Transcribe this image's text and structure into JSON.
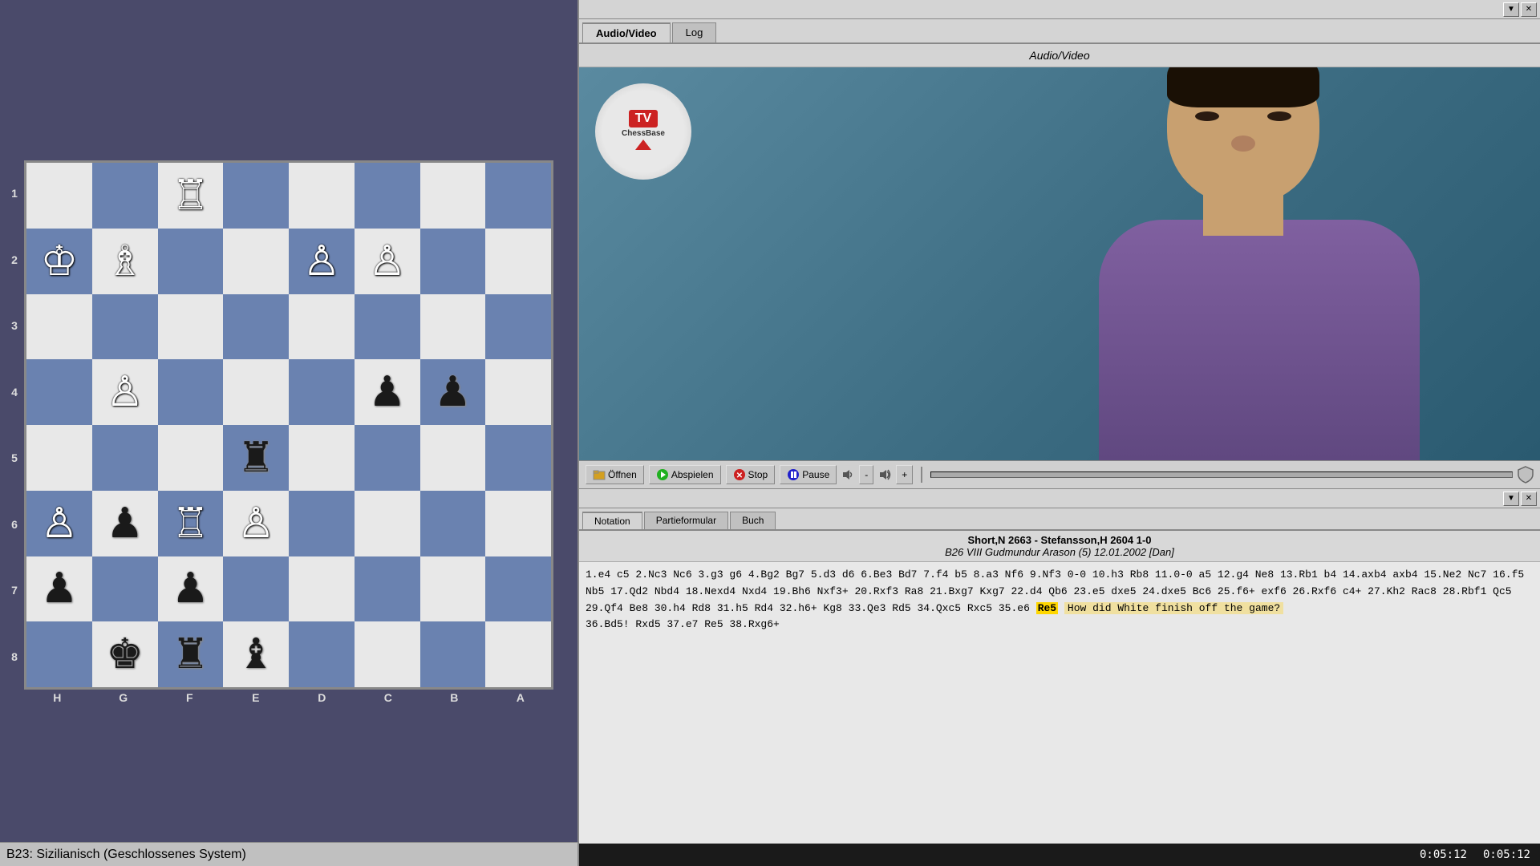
{
  "left_panel": {
    "status_bar": "B23: Sizilianisch (Geschlossenes System)",
    "file_labels": [
      "H",
      "G",
      "F",
      "E",
      "D",
      "C",
      "B",
      "A"
    ],
    "rank_labels": [
      "1",
      "2",
      "3",
      "4",
      "5",
      "6",
      "7",
      "8"
    ],
    "board": {
      "pieces": [
        {
          "row": 0,
          "col": 2,
          "piece": "♜",
          "color": "white",
          "symbol": "♖"
        },
        {
          "row": 1,
          "col": 0,
          "piece": "♚",
          "color": "white",
          "symbol": "♔"
        },
        {
          "row": 1,
          "col": 1,
          "piece": "♝",
          "color": "white",
          "symbol": "♗"
        },
        {
          "row": 1,
          "col": 4,
          "piece": "♟",
          "color": "white",
          "symbol": "♙"
        },
        {
          "row": 1,
          "col": 5,
          "piece": "♟",
          "color": "white",
          "symbol": "♙"
        },
        {
          "row": 3,
          "col": 1,
          "piece": "♟",
          "color": "white",
          "symbol": "♙"
        },
        {
          "row": 3,
          "col": 4,
          "piece": "♟",
          "color": "black",
          "symbol": "♟"
        },
        {
          "row": 3,
          "col": 5,
          "piece": "♟",
          "color": "black",
          "symbol": "♟"
        },
        {
          "row": 4,
          "col": 3,
          "piece": "♜",
          "color": "black",
          "symbol": "♜"
        },
        {
          "row": 5,
          "col": 0,
          "piece": "♟",
          "color": "white",
          "symbol": "♙"
        },
        {
          "row": 5,
          "col": 1,
          "piece": "♟",
          "color": "black",
          "symbol": "♟"
        },
        {
          "row": 5,
          "col": 2,
          "piece": "♜",
          "color": "white",
          "symbol": "♖"
        },
        {
          "row": 5,
          "col": 3,
          "piece": "♟",
          "color": "white",
          "symbol": "♙"
        },
        {
          "row": 6,
          "col": 0,
          "piece": "♟",
          "color": "black",
          "symbol": "♟"
        },
        {
          "row": 6,
          "col": 2,
          "piece": "♟",
          "color": "black",
          "symbol": "♟"
        },
        {
          "row": 7,
          "col": 1,
          "piece": "♚",
          "color": "black",
          "symbol": "♚"
        },
        {
          "row": 7,
          "col": 2,
          "piece": "♜",
          "color": "black",
          "symbol": "♜"
        },
        {
          "row": 7,
          "col": 3,
          "piece": "♝",
          "color": "black",
          "symbol": "♝"
        }
      ]
    }
  },
  "right_panel": {
    "tabs": [
      "Audio/Video",
      "Log"
    ],
    "active_tab": "Audio/Video",
    "av_label": "Audio/Video",
    "logo": {
      "tv": "TV",
      "chessbase": "ChessBase"
    },
    "controls": {
      "open": "Öffnen",
      "play": "Abspielen",
      "stop": "Stop",
      "pause": "Pause",
      "vol_minus": "-",
      "vol_plus": "+"
    }
  },
  "notation": {
    "tabs": [
      "Notation",
      "Partieformular",
      "Buch"
    ],
    "active_tab": "Notation",
    "game_title": "Short,N 2663 - Stefansson,H 2604  1-0",
    "game_info": "B26 VIII Gudmundur Arason (5) 12.01.2002 [Dan]",
    "moves": "1.e4 c5 2.Nc3 Nc6 3.g3 g6 4.Bg2 Bg7 5.d3 d6 6.Be3 Bd7 7.f4 b5 8.a3 Nf6 9.Nf3 0-0 10.h3 Rb8 11.0-0 a5 12.g4 Ne8 13.Rb1 b4 14.axb4 axb4 15.Ne2 Nc7 16.f5 Nb5 17.Qd2 Nbd4 18.Nexd4 Nxd4 19.Bh6 Nxf3+ 20.Rxf3 Ra8 21.Bxg7 Kxg7 22.d4 Qb6 23.e5 dxe5 24.dxe5 Bc6 25.f6+ exf6 26.Rxf6 c4+ 27.Kh2 Rac8 28.Rbf1 Qc5 29.Qf4 Be8 30.h4 Rd8 31.h5 Rd4 32.h6+ Kg8 33.Qe3 Rd5 34.Qxc5 Rxc5 35.e6 Re5  How did White finish off the game? 36.Bd5! Rxd5 37.e7 Re5 38.Rxg6+",
    "highlight_move": "Re5",
    "question": "How did White finish off the game?"
  },
  "status": {
    "time1": "0:05:12",
    "time2": "0:05:12"
  },
  "window_controls": {
    "minimize": "▼",
    "close": "✕"
  }
}
